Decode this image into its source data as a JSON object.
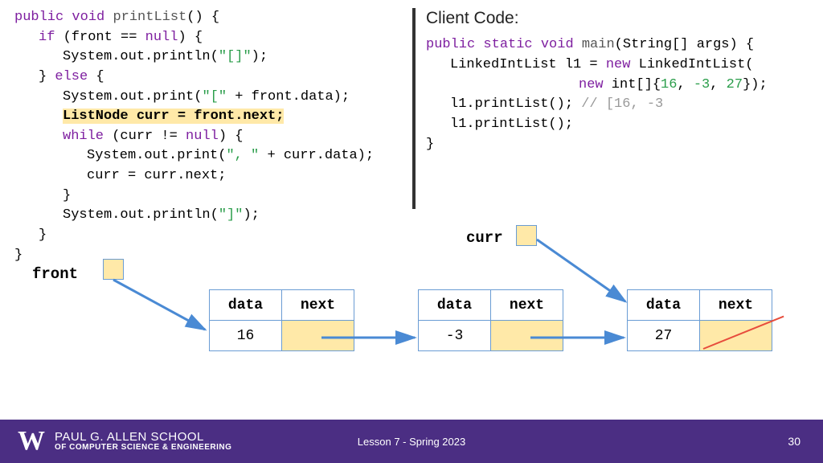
{
  "code": {
    "l1a": "public",
    "l1b": "void",
    "l1c": "printList",
    "l1d": "() {",
    "l2a": "if",
    "l2b": " (front == ",
    "l2c": "null",
    "l2d": ") {",
    "l3a": "System.out.println(",
    "l3b": "\"[]\"",
    "l3c": ");",
    "l4a": "} ",
    "l4b": "else",
    "l4c": " {",
    "l5a": "System.out.print(",
    "l5b": "\"[\"",
    "l5c": " + front.data);",
    "l6": "ListNode curr = front.next;",
    "l7a": "while",
    "l7b": " (curr != ",
    "l7c": "null",
    "l7d": ") {",
    "l8a": "System.out.print(",
    "l8b": "\", \"",
    "l8c": " + curr.data);",
    "l9": "curr = curr.next;",
    "l10": "}",
    "l11a": "System.out.println(",
    "l11b": "\"]\"",
    "l11c": ");",
    "l12": "}",
    "l13": "}"
  },
  "client": {
    "title": "Client Code:",
    "l1a": "public",
    "l1b": "static",
    "l1c": "void",
    "l1d": "main",
    "l1e": "(String[] args) {",
    "l2a": "LinkedIntList l1 = ",
    "l2b": "new",
    "l2c": " LinkedIntList(",
    "l3a": "new",
    "l3b": " int[]{",
    "l3c": "16",
    "l3d": ", ",
    "l3e": "-3",
    "l3f": ", ",
    "l3g": "27",
    "l3h": "});",
    "l4a": "l1.printList(); ",
    "l4b": "// [16, -3",
    "l5": "l1.printList();",
    "l6": "}"
  },
  "diagram": {
    "front": "front",
    "curr": "curr",
    "data": "data",
    "next": "next",
    "v1": "16",
    "v2": "-3",
    "v3": "27"
  },
  "footer": {
    "w": "W",
    "school_top": "PAUL G. ALLEN SCHOOL",
    "school_bot": "OF COMPUTER SCIENCE & ENGINEERING",
    "lesson": "Lesson 7 - Spring 2023",
    "page": "30"
  }
}
